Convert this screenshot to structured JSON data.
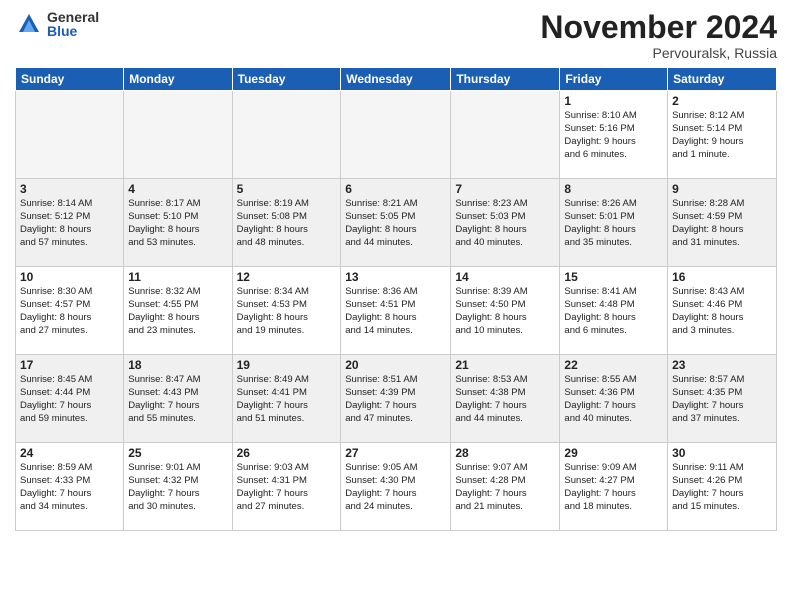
{
  "header": {
    "logo_general": "General",
    "logo_blue": "Blue",
    "month_title": "November 2024",
    "location": "Pervouralsk, Russia"
  },
  "days_of_week": [
    "Sunday",
    "Monday",
    "Tuesday",
    "Wednesday",
    "Thursday",
    "Friday",
    "Saturday"
  ],
  "weeks": [
    [
      {
        "day": "",
        "info": ""
      },
      {
        "day": "",
        "info": ""
      },
      {
        "day": "",
        "info": ""
      },
      {
        "day": "",
        "info": ""
      },
      {
        "day": "",
        "info": ""
      },
      {
        "day": "1",
        "info": "Sunrise: 8:10 AM\nSunset: 5:16 PM\nDaylight: 9 hours\nand 6 minutes."
      },
      {
        "day": "2",
        "info": "Sunrise: 8:12 AM\nSunset: 5:14 PM\nDaylight: 9 hours\nand 1 minute."
      }
    ],
    [
      {
        "day": "3",
        "info": "Sunrise: 8:14 AM\nSunset: 5:12 PM\nDaylight: 8 hours\nand 57 minutes."
      },
      {
        "day": "4",
        "info": "Sunrise: 8:17 AM\nSunset: 5:10 PM\nDaylight: 8 hours\nand 53 minutes."
      },
      {
        "day": "5",
        "info": "Sunrise: 8:19 AM\nSunset: 5:08 PM\nDaylight: 8 hours\nand 48 minutes."
      },
      {
        "day": "6",
        "info": "Sunrise: 8:21 AM\nSunset: 5:05 PM\nDaylight: 8 hours\nand 44 minutes."
      },
      {
        "day": "7",
        "info": "Sunrise: 8:23 AM\nSunset: 5:03 PM\nDaylight: 8 hours\nand 40 minutes."
      },
      {
        "day": "8",
        "info": "Sunrise: 8:26 AM\nSunset: 5:01 PM\nDaylight: 8 hours\nand 35 minutes."
      },
      {
        "day": "9",
        "info": "Sunrise: 8:28 AM\nSunset: 4:59 PM\nDaylight: 8 hours\nand 31 minutes."
      }
    ],
    [
      {
        "day": "10",
        "info": "Sunrise: 8:30 AM\nSunset: 4:57 PM\nDaylight: 8 hours\nand 27 minutes."
      },
      {
        "day": "11",
        "info": "Sunrise: 8:32 AM\nSunset: 4:55 PM\nDaylight: 8 hours\nand 23 minutes."
      },
      {
        "day": "12",
        "info": "Sunrise: 8:34 AM\nSunset: 4:53 PM\nDaylight: 8 hours\nand 19 minutes."
      },
      {
        "day": "13",
        "info": "Sunrise: 8:36 AM\nSunset: 4:51 PM\nDaylight: 8 hours\nand 14 minutes."
      },
      {
        "day": "14",
        "info": "Sunrise: 8:39 AM\nSunset: 4:50 PM\nDaylight: 8 hours\nand 10 minutes."
      },
      {
        "day": "15",
        "info": "Sunrise: 8:41 AM\nSunset: 4:48 PM\nDaylight: 8 hours\nand 6 minutes."
      },
      {
        "day": "16",
        "info": "Sunrise: 8:43 AM\nSunset: 4:46 PM\nDaylight: 8 hours\nand 3 minutes."
      }
    ],
    [
      {
        "day": "17",
        "info": "Sunrise: 8:45 AM\nSunset: 4:44 PM\nDaylight: 7 hours\nand 59 minutes."
      },
      {
        "day": "18",
        "info": "Sunrise: 8:47 AM\nSunset: 4:43 PM\nDaylight: 7 hours\nand 55 minutes."
      },
      {
        "day": "19",
        "info": "Sunrise: 8:49 AM\nSunset: 4:41 PM\nDaylight: 7 hours\nand 51 minutes."
      },
      {
        "day": "20",
        "info": "Sunrise: 8:51 AM\nSunset: 4:39 PM\nDaylight: 7 hours\nand 47 minutes."
      },
      {
        "day": "21",
        "info": "Sunrise: 8:53 AM\nSunset: 4:38 PM\nDaylight: 7 hours\nand 44 minutes."
      },
      {
        "day": "22",
        "info": "Sunrise: 8:55 AM\nSunset: 4:36 PM\nDaylight: 7 hours\nand 40 minutes."
      },
      {
        "day": "23",
        "info": "Sunrise: 8:57 AM\nSunset: 4:35 PM\nDaylight: 7 hours\nand 37 minutes."
      }
    ],
    [
      {
        "day": "24",
        "info": "Sunrise: 8:59 AM\nSunset: 4:33 PM\nDaylight: 7 hours\nand 34 minutes."
      },
      {
        "day": "25",
        "info": "Sunrise: 9:01 AM\nSunset: 4:32 PM\nDaylight: 7 hours\nand 30 minutes."
      },
      {
        "day": "26",
        "info": "Sunrise: 9:03 AM\nSunset: 4:31 PM\nDaylight: 7 hours\nand 27 minutes."
      },
      {
        "day": "27",
        "info": "Sunrise: 9:05 AM\nSunset: 4:30 PM\nDaylight: 7 hours\nand 24 minutes."
      },
      {
        "day": "28",
        "info": "Sunrise: 9:07 AM\nSunset: 4:28 PM\nDaylight: 7 hours\nand 21 minutes."
      },
      {
        "day": "29",
        "info": "Sunrise: 9:09 AM\nSunset: 4:27 PM\nDaylight: 7 hours\nand 18 minutes."
      },
      {
        "day": "30",
        "info": "Sunrise: 9:11 AM\nSunset: 4:26 PM\nDaylight: 7 hours\nand 15 minutes."
      }
    ]
  ]
}
